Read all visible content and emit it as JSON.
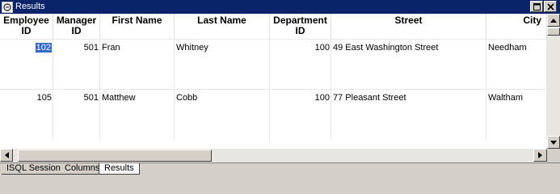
{
  "window": {
    "title": "Results"
  },
  "columns": [
    "Employee ID",
    "Manager ID",
    "First Name",
    "Last Name",
    "Department ID",
    "Street",
    "City"
  ],
  "rows": [
    {
      "employee_id": "102",
      "manager_id": "501",
      "first_name": "Fran",
      "last_name": "Whitney",
      "department_id": "100",
      "street": "49 East Washington Street",
      "city": "Needham"
    },
    {
      "employee_id": "105",
      "manager_id": "501",
      "first_name": "Matthew",
      "last_name": "Cobb",
      "department_id": "100",
      "street": "77 Pleasant Street",
      "city": "Waltham"
    }
  ],
  "tabs": [
    {
      "label": "ISQL Session",
      "active": false
    },
    {
      "label": "Columns",
      "active": false
    },
    {
      "label": "Results",
      "active": true
    }
  ],
  "icons": {
    "title": "window-icon",
    "maximize": "maximize-icon",
    "close": "close-icon"
  },
  "colors": {
    "titlebar": "#0a246a",
    "selection": "#316ac5",
    "chrome": "#d4d0c8"
  }
}
